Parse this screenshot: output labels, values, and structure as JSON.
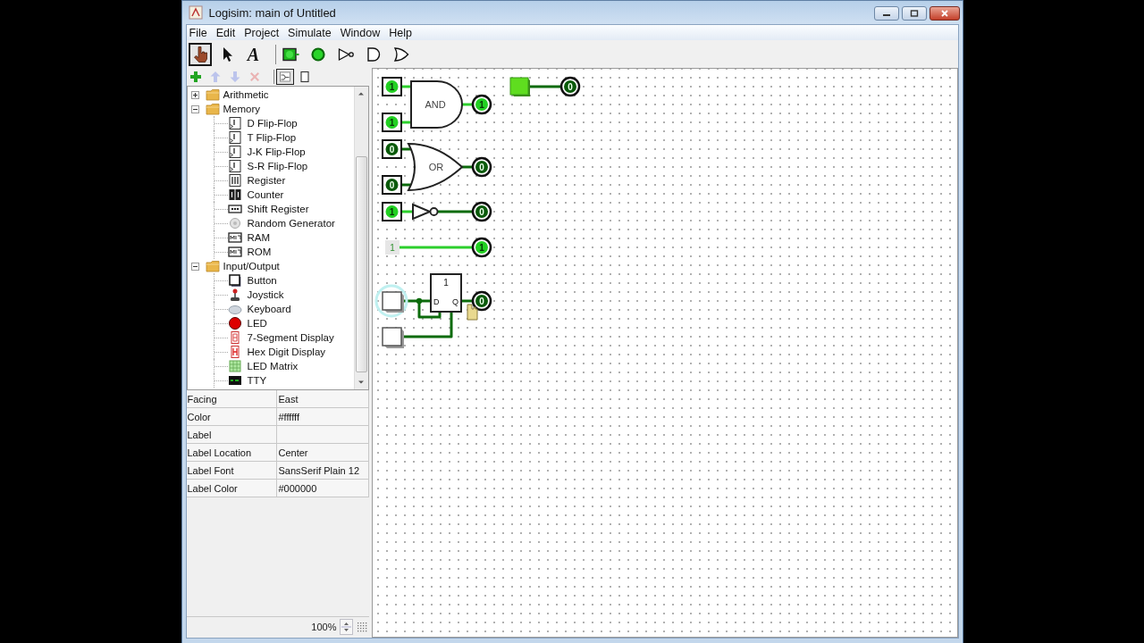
{
  "window": {
    "title": "Logisim: main of Untitled"
  },
  "menu": [
    "File",
    "Edit",
    "Project",
    "Simulate",
    "Window",
    "Help"
  ],
  "toolbar": {
    "tools": [
      {
        "kind": "poke",
        "selected": true
      },
      {
        "kind": "select",
        "selected": false
      },
      {
        "kind": "text",
        "glyph": "A",
        "selected": false
      }
    ],
    "components": [
      {
        "kind": "input_pin",
        "selected": false
      },
      {
        "kind": "output_pin",
        "selected": false
      },
      {
        "kind": "not_gate",
        "selected": false
      },
      {
        "kind": "and_gate",
        "selected": false
      },
      {
        "kind": "or_gate",
        "selected": false
      }
    ]
  },
  "explorer_toolbar": {
    "actions": [
      {
        "kind": "add",
        "disabled": false
      },
      {
        "kind": "up",
        "disabled": true
      },
      {
        "kind": "down",
        "disabled": true
      },
      {
        "kind": "delete",
        "disabled": true
      }
    ],
    "views": [
      {
        "kind": "layout",
        "selected": true
      },
      {
        "kind": "appearance",
        "selected": false
      }
    ]
  },
  "tree": [
    {
      "label": "Arithmetic",
      "expanded": false
    },
    {
      "label": "Memory",
      "expanded": true,
      "children": [
        {
          "label": "D Flip-Flop",
          "kind": "flipflop"
        },
        {
          "label": "T Flip-Flop",
          "kind": "flipflop"
        },
        {
          "label": "J-K Flip-Flop",
          "kind": "flipflop"
        },
        {
          "label": "S-R Flip-Flop",
          "kind": "flipflop"
        },
        {
          "label": "Register",
          "kind": "register"
        },
        {
          "label": "Counter",
          "kind": "counter"
        },
        {
          "label": "Shift Register",
          "kind": "shift_register"
        },
        {
          "label": "Random Generator",
          "kind": "random"
        },
        {
          "label": "RAM",
          "kind": "memory"
        },
        {
          "label": "ROM",
          "kind": "memory"
        }
      ]
    },
    {
      "label": "Input/Output",
      "expanded": true,
      "children": [
        {
          "label": "Button",
          "kind": "button"
        },
        {
          "label": "Joystick",
          "kind": "joystick"
        },
        {
          "label": "Keyboard",
          "kind": "keyboard"
        },
        {
          "label": "LED",
          "kind": "led"
        },
        {
          "label": "7-Segment Display",
          "kind": "seven_segment"
        },
        {
          "label": "Hex Digit Display",
          "kind": "hex_display"
        },
        {
          "label": "LED Matrix",
          "kind": "led_matrix"
        },
        {
          "label": "TTY",
          "kind": "tty"
        }
      ]
    }
  ],
  "attributes": [
    {
      "name": "Facing",
      "value": "East"
    },
    {
      "name": "Color",
      "value": "#ffffff"
    },
    {
      "name": "Label"
    },
    {
      "name": "Label Location",
      "value": "Center"
    },
    {
      "name": "Label Font",
      "value": "SansSerif Plain 12"
    },
    {
      "name": "Label Color",
      "value": "#000000"
    }
  ],
  "zoom": {
    "value": "100%"
  },
  "circuit": {
    "top_button": {
      "selected": false,
      "output": {
        "value": "0",
        "high": false
      }
    },
    "rows": [
      {
        "kind": "and",
        "label": "AND",
        "inputs": [
          {
            "value": "1",
            "high": true
          },
          {
            "value": "1",
            "high": true
          }
        ],
        "output": {
          "value": "1",
          "high": true
        }
      },
      {
        "kind": "or",
        "label": "OR",
        "inputs": [
          {
            "value": "0",
            "high": false
          },
          {
            "value": "0",
            "high": false
          }
        ],
        "output": {
          "value": "0",
          "high": false
        }
      },
      {
        "kind": "not",
        "inputs": [
          {
            "value": "1",
            "high": true
          }
        ],
        "output": {
          "value": "0",
          "high": false
        }
      },
      {
        "kind": "constant",
        "value": "1",
        "output": {
          "value": "1",
          "high": true
        }
      },
      {
        "kind": "flipflop",
        "state": "1",
        "input_label": "D",
        "output_label": "Q",
        "buttons": [
          {
            "selected": true,
            "high": false
          },
          {
            "selected": false,
            "high": false
          }
        ],
        "output": {
          "value": "0",
          "high": false
        }
      }
    ]
  }
}
